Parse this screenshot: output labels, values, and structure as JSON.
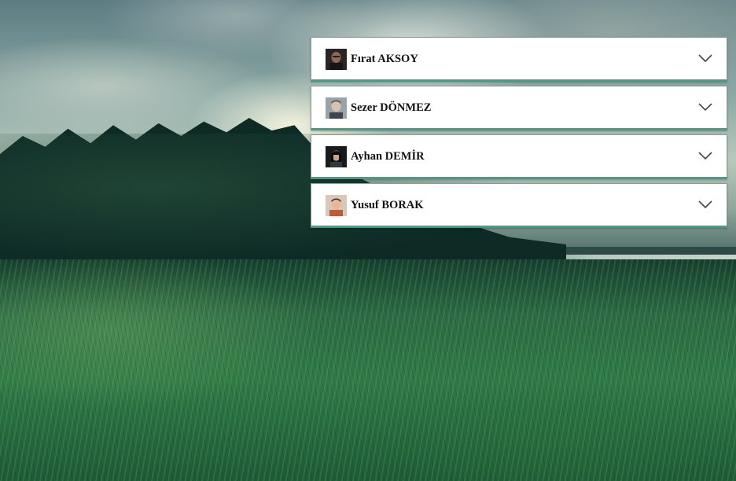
{
  "background": {
    "description_icon": "landscape-photo"
  },
  "accordion": {
    "items": [
      {
        "name": "Fırat AKSOY",
        "avatar_icon": "avatar-photo",
        "chevron_icon": "chevron-down-icon"
      },
      {
        "name": "Sezer DÖNMEZ",
        "avatar_icon": "avatar-photo",
        "chevron_icon": "chevron-down-icon"
      },
      {
        "name": "Ayhan DEMİR",
        "avatar_icon": "avatar-photo",
        "chevron_icon": "chevron-down-icon"
      },
      {
        "name": "Yusuf BORAK",
        "avatar_icon": "avatar-photo",
        "chevron_icon": "chevron-down-icon"
      }
    ]
  },
  "colors": {
    "panel_bg": "#ffffff",
    "accent_border": "#3fa08a",
    "text": "#111111"
  }
}
